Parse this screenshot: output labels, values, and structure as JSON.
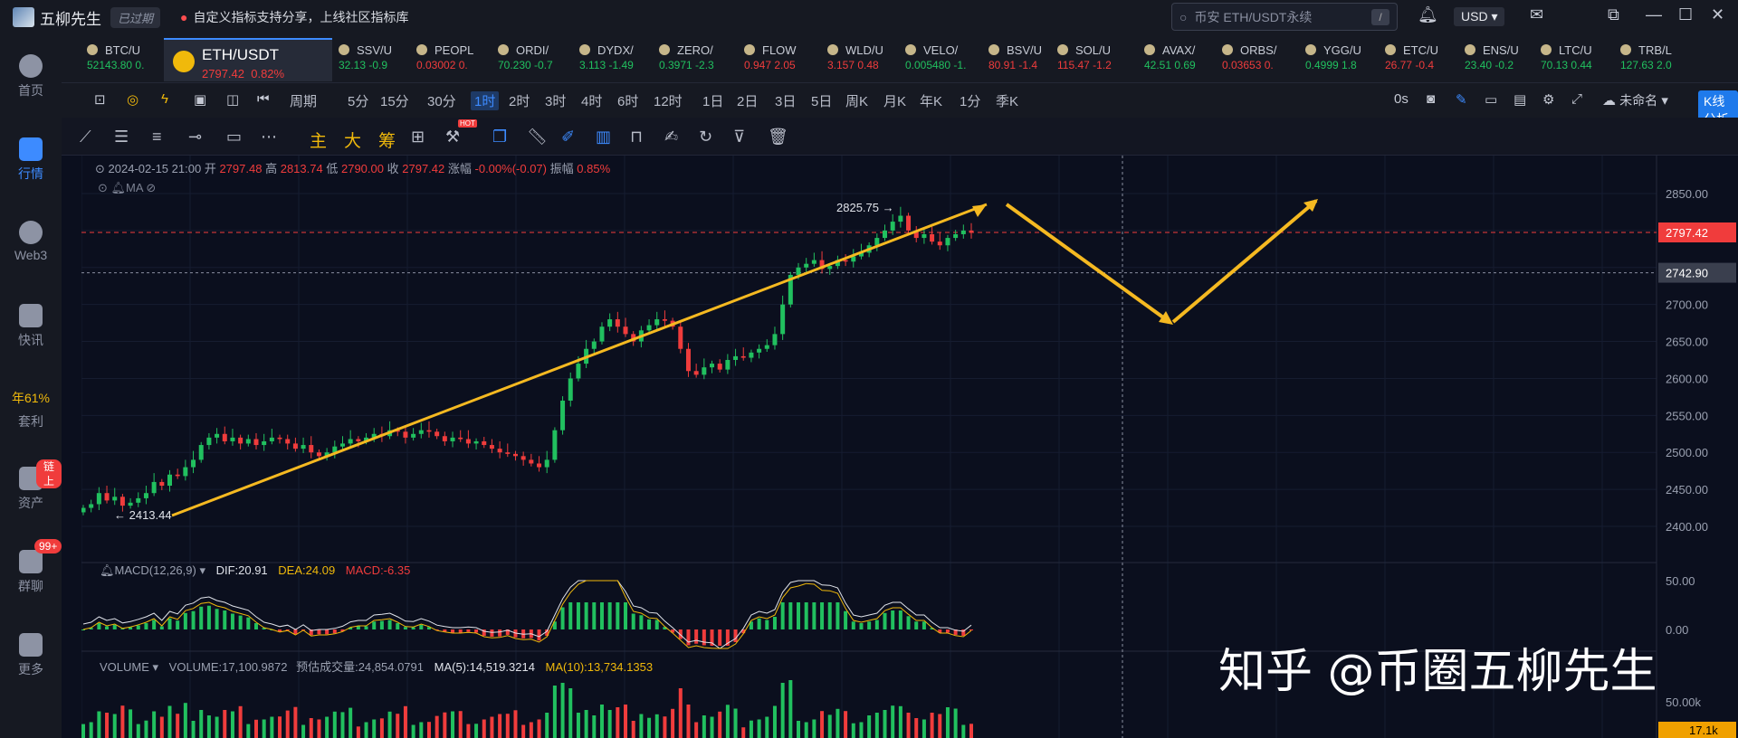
{
  "titlebar": {
    "app_name": "五柳先生",
    "expired_badge": "已过期",
    "notice": "自定义指标支持分享，上线社区指标库",
    "search_placeholder": "币安 ETH/USDT永续",
    "search_hotkey": "/",
    "currency": "USD"
  },
  "sidebar": {
    "items": [
      {
        "label": "首页"
      },
      {
        "label": "行情"
      },
      {
        "label": "Web3"
      },
      {
        "label": "快讯"
      },
      {
        "label": "年61%",
        "sub": "套利"
      },
      {
        "label": "资产",
        "badge": "链上"
      },
      {
        "label": "群聊",
        "badge": "99+"
      },
      {
        "label": "更多"
      }
    ]
  },
  "tickers": [
    {
      "name": "BTC/U",
      "price": "52143.80",
      "chg": "0.",
      "dir": "up"
    },
    {
      "name": "SSV/U",
      "price": "32.13",
      "chg": "-0.9",
      "dir": "up"
    },
    {
      "name": "PEOPL",
      "price": "0.03002",
      "chg": "0.",
      "dir": "down"
    },
    {
      "name": "ORDI/",
      "price": "70.230",
      "chg": "-0.7",
      "dir": "up"
    },
    {
      "name": "DYDX/",
      "price": "3.113",
      "chg": "-1.49",
      "dir": "up"
    },
    {
      "name": "ZERO/",
      "price": "0.3971",
      "chg": "-2.3",
      "dir": "up"
    },
    {
      "name": "FLOW",
      "price": "0.947",
      "chg": "2.05",
      "dir": "down"
    },
    {
      "name": "WLD/U",
      "price": "3.157",
      "chg": "0.48",
      "dir": "down"
    },
    {
      "name": "VELO/",
      "price": "0.005480",
      "chg": "-1.",
      "dir": "up"
    },
    {
      "name": "BSV/U",
      "price": "80.91",
      "chg": "-1.4",
      "dir": "down"
    },
    {
      "name": "SOL/U",
      "price": "115.47",
      "chg": "-1.2",
      "dir": "down"
    },
    {
      "name": "AVAX/",
      "price": "42.51",
      "chg": "0.69",
      "dir": "up"
    },
    {
      "name": "ORBS/",
      "price": "0.03653",
      "chg": "0.",
      "dir": "down"
    },
    {
      "name": "YGG/U",
      "price": "0.4999",
      "chg": "1.8",
      "dir": "up"
    },
    {
      "name": "ETC/U",
      "price": "26.77",
      "chg": "-0.4",
      "dir": "down"
    },
    {
      "name": "ENS/U",
      "price": "23.40",
      "chg": "-0.2",
      "dir": "up"
    },
    {
      "name": "LTC/U",
      "price": "70.13",
      "chg": "0.44",
      "dir": "up"
    },
    {
      "name": "TRB/L",
      "price": "127.63",
      "chg": "2.0",
      "dir": "up"
    }
  ],
  "active_ticker": {
    "name": "ETH/USDT",
    "price": "2797.42",
    "chg": "0.82%"
  },
  "periods": [
    "周期",
    "5分",
    "15分",
    "30分",
    "1时",
    "2时",
    "3时",
    "4时",
    "6时",
    "12时",
    "1日",
    "2日",
    "3日",
    "5日",
    "周K",
    "月K",
    "年K",
    "1分",
    "季K"
  ],
  "active_period": "1时",
  "toolbar_right": {
    "timer": "0s",
    "unnamed": "未命名",
    "kline_btn": "K线分析"
  },
  "draw_tools_cn": [
    "主",
    "大",
    "筹"
  ],
  "hot_label": "HOT",
  "info": {
    "datetime": "2024-02-15 21:00",
    "open_label": "开",
    "open": "2797.48",
    "high_label": "高",
    "high": "2813.74",
    "low_label": "低",
    "low": "2790.00",
    "close_label": "收",
    "close": "2797.42",
    "chg_label": "涨幅",
    "chg": "-0.00%(-0.07)",
    "amp_label": "振幅",
    "amp": "0.85%"
  },
  "ma_label": "MA",
  "macd": {
    "name": "MACD(12,26,9)",
    "dif": "DIF:20.91",
    "dea": "DEA:24.09",
    "macd": "MACD:-6.35"
  },
  "volume": {
    "name": "VOLUME",
    "vol": "VOLUME:17,100.9872",
    "est": "预估成交量:24,854.0791",
    "ma5": "MA(5):14,519.3214",
    "ma10": "MA(10):13,734.1353"
  },
  "price_axis": [
    "2850.00",
    "2800.00",
    "2750.00",
    "2700.00",
    "2650.00",
    "2600.00",
    "2550.00",
    "2500.00",
    "2450.00",
    "2400.00"
  ],
  "macd_axis": [
    "50.00",
    "0.00"
  ],
  "vol_axis": [
    "50.00k"
  ],
  "current_price": "2797.42",
  "crosshair_price": "2742.90",
  "vol_tag": "17.1k",
  "high_mark": "2825.75 →",
  "low_mark": "← 2413.44",
  "watermark": "知乎 @币圈五柳先生",
  "chart_data": {
    "type": "candlestick",
    "title": "ETH/USDT 1时",
    "ylim": [
      2380,
      2870
    ],
    "closes": [
      2425,
      2430,
      2445,
      2435,
      2440,
      2428,
      2432,
      2438,
      2445,
      2460,
      2455,
      2470,
      2468,
      2480,
      2490,
      2510,
      2520,
      2525,
      2515,
      2520,
      2512,
      2518,
      2510,
      2515,
      2520,
      2518,
      2512,
      2505,
      2510,
      2500,
      2495,
      2500,
      2508,
      2512,
      2518,
      2515,
      2520,
      2525,
      2522,
      2530,
      2528,
      2520,
      2525,
      2530,
      2528,
      2522,
      2515,
      2520,
      2518,
      2512,
      2515,
      2510,
      2505,
      2500,
      2498,
      2495,
      2490,
      2485,
      2480,
      2490,
      2530,
      2570,
      2600,
      2620,
      2640,
      2650,
      2670,
      2680,
      2670,
      2660,
      2650,
      2665,
      2672,
      2680,
      2678,
      2670,
      2640,
      2610,
      2605,
      2615,
      2620,
      2612,
      2625,
      2630,
      2628,
      2635,
      2640,
      2645,
      2660,
      2700,
      2740,
      2750,
      2755,
      2760,
      2748,
      2752,
      2760,
      2758,
      2765,
      2770,
      2780,
      2790,
      2800,
      2812,
      2820,
      2800,
      2790,
      2795,
      2785,
      2780,
      2790,
      2795,
      2800,
      2797
    ],
    "projection": [
      "2840 → 2680 → 2840"
    ]
  }
}
